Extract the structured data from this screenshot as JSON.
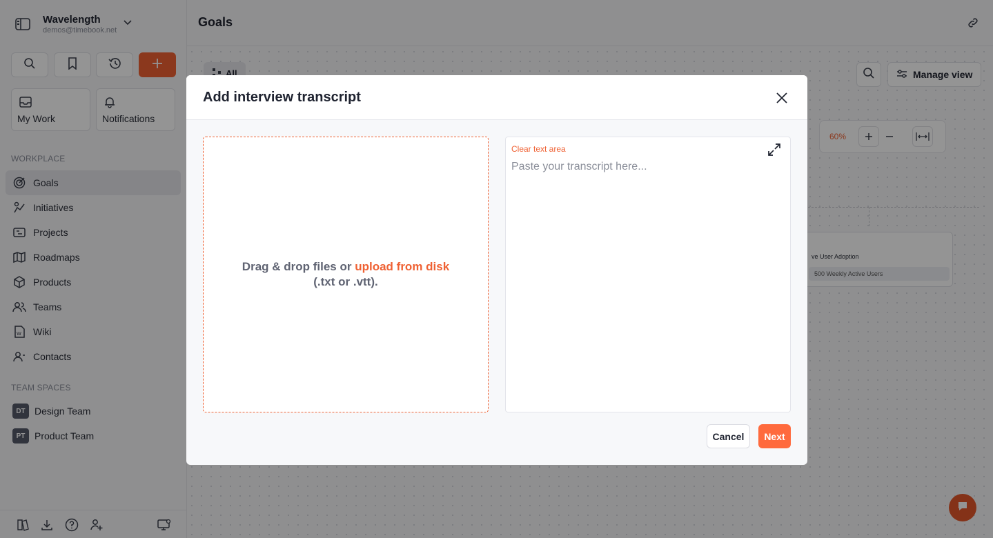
{
  "workspace": {
    "name": "Wavelength",
    "email": "demos@timebook.net"
  },
  "shortcuts": {
    "my_work": "My Work",
    "notifications": "Notifications"
  },
  "sections": {
    "workplace": "WORKPLACE",
    "team_spaces": "TEAM SPACES"
  },
  "nav": [
    {
      "label": "Goals",
      "icon": "target-icon",
      "active": true
    },
    {
      "label": "Initiatives",
      "icon": "initiatives-icon"
    },
    {
      "label": "Projects",
      "icon": "projects-icon"
    },
    {
      "label": "Roadmaps",
      "icon": "map-icon"
    },
    {
      "label": "Products",
      "icon": "box-icon"
    },
    {
      "label": "Teams",
      "icon": "users-icon"
    },
    {
      "label": "Wiki",
      "icon": "wiki-icon"
    },
    {
      "label": "Contacts",
      "icon": "contacts-icon"
    }
  ],
  "team_spaces": [
    {
      "badge": "DT",
      "label": "Design Team"
    },
    {
      "badge": "PT",
      "label": "Product Team"
    }
  ],
  "header": {
    "title": "Goals"
  },
  "canvas": {
    "view_chip": "All",
    "manage_view": "Manage view",
    "zoom": "60%",
    "card_title": "ve User Adoption",
    "card_metric": "500 Weekly Active Users"
  },
  "modal": {
    "title": "Add interview transcript",
    "drop_text": "Drag & drop files or ",
    "drop_link": "upload from disk",
    "drop_formats": "(.txt or .vtt).",
    "clear_text": "Clear text area",
    "placeholder": "Paste your transcript here...",
    "cancel": "Cancel",
    "next": "Next"
  },
  "colors": {
    "accent": "#ef6133",
    "next_button": "#ff6a3d"
  }
}
